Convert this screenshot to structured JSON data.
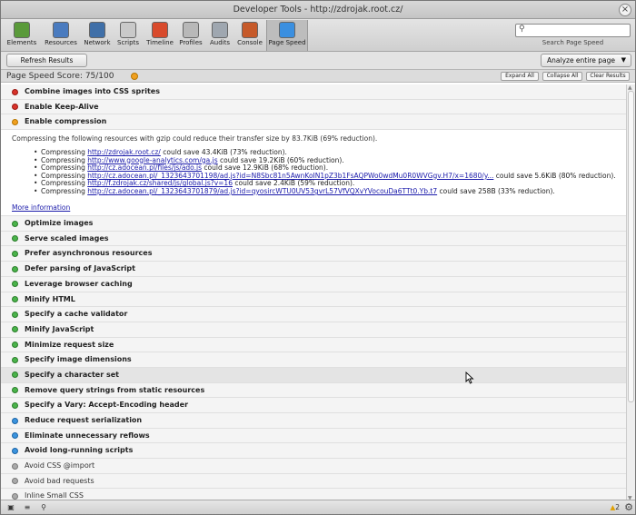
{
  "window": {
    "title": "Developer Tools - http://zdrojak.root.cz/"
  },
  "toolbar": {
    "tools": [
      {
        "label": "Elements",
        "icon": "elements-icon",
        "color": "#5a9a3a"
      },
      {
        "label": "Resources",
        "icon": "resources-icon",
        "color": "#4a7bbf"
      },
      {
        "label": "Network",
        "icon": "network-icon",
        "color": "#3f6fa8"
      },
      {
        "label": "Scripts",
        "icon": "scripts-icon",
        "color": "#c9c9c9"
      },
      {
        "label": "Timeline",
        "icon": "timeline-icon",
        "color": "#d84a2c"
      },
      {
        "label": "Profiles",
        "icon": "profiles-icon",
        "color": "#b8b8b8"
      },
      {
        "label": "Audits",
        "icon": "audits-icon",
        "color": "#9fa7b0"
      },
      {
        "label": "Console",
        "icon": "console-icon",
        "color": "#c65a2a"
      },
      {
        "label": "Page Speed",
        "icon": "page-speed-icon",
        "color": "#3a8fe0"
      }
    ],
    "search_label": "Search Page Speed",
    "search_placeholder": ""
  },
  "actions": {
    "refresh_label": "Refresh Results",
    "analyze_value": "Analyze entire page"
  },
  "score": {
    "text": "Page Speed Score: 75/100",
    "expand_all": "Expand All",
    "collapse_all": "Collapse All",
    "clear_results": "Clear Results"
  },
  "rules_top": [
    {
      "label": "Combine images into CSS sprites",
      "status": "red"
    },
    {
      "label": "Enable Keep-Alive",
      "status": "red"
    },
    {
      "label": "Enable compression",
      "status": "orange"
    }
  ],
  "detail": {
    "summary": "Compressing the following resources with gzip could reduce their transfer size by 83.7KiB (69% reduction).",
    "items": [
      {
        "prefix": "Compressing ",
        "url": "http://zdrojak.root.cz/",
        "suffix": " could save 43.4KiB (73% reduction)."
      },
      {
        "prefix": "Compressing ",
        "url": "http://www.google-analytics.com/ga.js",
        "suffix": " could save 19.2KiB (60% reduction)."
      },
      {
        "prefix": "Compressing ",
        "url": "http://cz.adocean.pl/files/js/ado.js",
        "suffix": " could save 12.9KiB (68% reduction)."
      },
      {
        "prefix": "Compressing ",
        "url": "http://cz.adocean.pl/_1323643701198/ad.js?id=N8Sbc81n5AwnKoIN1pZ3b1FsAQPWo0wdMu0R0WVGgv.H7/x=1680/y...",
        "suffix": " could save 5.6KiB (80% reduction)."
      },
      {
        "prefix": "Compressing ",
        "url": "http://f.zdrojak.cz/shared/js/global.js?v=16",
        "suffix": " could save 2.4KiB (59% reduction)."
      },
      {
        "prefix": "Compressing ",
        "url": "http://cz.adocean.pl/_1323643701879/ad.js?id=qyosircWTU0UV53gvrL57VfVQXvYVocouDa6TTt0.Yb.t7",
        "suffix": " could save 258B (33% reduction)."
      }
    ],
    "more_info": "More information"
  },
  "rules_bottom": [
    {
      "label": "Optimize images",
      "status": "green"
    },
    {
      "label": "Serve scaled images",
      "status": "green"
    },
    {
      "label": "Prefer asynchronous resources",
      "status": "green"
    },
    {
      "label": "Defer parsing of JavaScript",
      "status": "green"
    },
    {
      "label": "Leverage browser caching",
      "status": "green"
    },
    {
      "label": "Minify HTML",
      "status": "green"
    },
    {
      "label": "Specify a cache validator",
      "status": "green"
    },
    {
      "label": "Minify JavaScript",
      "status": "green"
    },
    {
      "label": "Minimize request size",
      "status": "green"
    },
    {
      "label": "Specify image dimensions",
      "status": "green"
    },
    {
      "label": "Specify a character set",
      "status": "green",
      "hover": true
    },
    {
      "label": "Remove query strings from static resources",
      "status": "green"
    },
    {
      "label": "Specify a Vary: Accept-Encoding header",
      "status": "green"
    },
    {
      "label": "Reduce request serialization",
      "status": "blue"
    },
    {
      "label": "Eliminate unnecessary reflows",
      "status": "blue"
    },
    {
      "label": "Avoid long-running scripts",
      "status": "blue"
    },
    {
      "label": "Avoid CSS @import",
      "status": "gray"
    },
    {
      "label": "Avoid bad requests",
      "status": "gray"
    },
    {
      "label": "Inline Small CSS",
      "status": "gray"
    }
  ],
  "statusbar": {
    "warnings": "2"
  }
}
